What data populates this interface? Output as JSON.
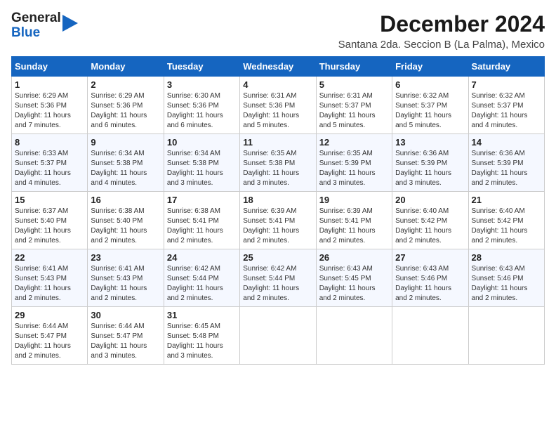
{
  "header": {
    "logo_line1": "General",
    "logo_line2": "Blue",
    "month": "December 2024",
    "location": "Santana 2da. Seccion B (La Palma), Mexico"
  },
  "days_of_week": [
    "Sunday",
    "Monday",
    "Tuesday",
    "Wednesday",
    "Thursday",
    "Friday",
    "Saturday"
  ],
  "weeks": [
    [
      {
        "day": "1",
        "info": "Sunrise: 6:29 AM\nSunset: 5:36 PM\nDaylight: 11 hours\nand 7 minutes."
      },
      {
        "day": "2",
        "info": "Sunrise: 6:29 AM\nSunset: 5:36 PM\nDaylight: 11 hours\nand 6 minutes."
      },
      {
        "day": "3",
        "info": "Sunrise: 6:30 AM\nSunset: 5:36 PM\nDaylight: 11 hours\nand 6 minutes."
      },
      {
        "day": "4",
        "info": "Sunrise: 6:31 AM\nSunset: 5:36 PM\nDaylight: 11 hours\nand 5 minutes."
      },
      {
        "day": "5",
        "info": "Sunrise: 6:31 AM\nSunset: 5:37 PM\nDaylight: 11 hours\nand 5 minutes."
      },
      {
        "day": "6",
        "info": "Sunrise: 6:32 AM\nSunset: 5:37 PM\nDaylight: 11 hours\nand 5 minutes."
      },
      {
        "day": "7",
        "info": "Sunrise: 6:32 AM\nSunset: 5:37 PM\nDaylight: 11 hours\nand 4 minutes."
      }
    ],
    [
      {
        "day": "8",
        "info": "Sunrise: 6:33 AM\nSunset: 5:37 PM\nDaylight: 11 hours\nand 4 minutes."
      },
      {
        "day": "9",
        "info": "Sunrise: 6:34 AM\nSunset: 5:38 PM\nDaylight: 11 hours\nand 4 minutes."
      },
      {
        "day": "10",
        "info": "Sunrise: 6:34 AM\nSunset: 5:38 PM\nDaylight: 11 hours\nand 3 minutes."
      },
      {
        "day": "11",
        "info": "Sunrise: 6:35 AM\nSunset: 5:38 PM\nDaylight: 11 hours\nand 3 minutes."
      },
      {
        "day": "12",
        "info": "Sunrise: 6:35 AM\nSunset: 5:39 PM\nDaylight: 11 hours\nand 3 minutes."
      },
      {
        "day": "13",
        "info": "Sunrise: 6:36 AM\nSunset: 5:39 PM\nDaylight: 11 hours\nand 3 minutes."
      },
      {
        "day": "14",
        "info": "Sunrise: 6:36 AM\nSunset: 5:39 PM\nDaylight: 11 hours\nand 2 minutes."
      }
    ],
    [
      {
        "day": "15",
        "info": "Sunrise: 6:37 AM\nSunset: 5:40 PM\nDaylight: 11 hours\nand 2 minutes."
      },
      {
        "day": "16",
        "info": "Sunrise: 6:38 AM\nSunset: 5:40 PM\nDaylight: 11 hours\nand 2 minutes."
      },
      {
        "day": "17",
        "info": "Sunrise: 6:38 AM\nSunset: 5:41 PM\nDaylight: 11 hours\nand 2 minutes."
      },
      {
        "day": "18",
        "info": "Sunrise: 6:39 AM\nSunset: 5:41 PM\nDaylight: 11 hours\nand 2 minutes."
      },
      {
        "day": "19",
        "info": "Sunrise: 6:39 AM\nSunset: 5:41 PM\nDaylight: 11 hours\nand 2 minutes."
      },
      {
        "day": "20",
        "info": "Sunrise: 6:40 AM\nSunset: 5:42 PM\nDaylight: 11 hours\nand 2 minutes."
      },
      {
        "day": "21",
        "info": "Sunrise: 6:40 AM\nSunset: 5:42 PM\nDaylight: 11 hours\nand 2 minutes."
      }
    ],
    [
      {
        "day": "22",
        "info": "Sunrise: 6:41 AM\nSunset: 5:43 PM\nDaylight: 11 hours\nand 2 minutes."
      },
      {
        "day": "23",
        "info": "Sunrise: 6:41 AM\nSunset: 5:43 PM\nDaylight: 11 hours\nand 2 minutes."
      },
      {
        "day": "24",
        "info": "Sunrise: 6:42 AM\nSunset: 5:44 PM\nDaylight: 11 hours\nand 2 minutes."
      },
      {
        "day": "25",
        "info": "Sunrise: 6:42 AM\nSunset: 5:44 PM\nDaylight: 11 hours\nand 2 minutes."
      },
      {
        "day": "26",
        "info": "Sunrise: 6:43 AM\nSunset: 5:45 PM\nDaylight: 11 hours\nand 2 minutes."
      },
      {
        "day": "27",
        "info": "Sunrise: 6:43 AM\nSunset: 5:46 PM\nDaylight: 11 hours\nand 2 minutes."
      },
      {
        "day": "28",
        "info": "Sunrise: 6:43 AM\nSunset: 5:46 PM\nDaylight: 11 hours\nand 2 minutes."
      }
    ],
    [
      {
        "day": "29",
        "info": "Sunrise: 6:44 AM\nSunset: 5:47 PM\nDaylight: 11 hours\nand 2 minutes."
      },
      {
        "day": "30",
        "info": "Sunrise: 6:44 AM\nSunset: 5:47 PM\nDaylight: 11 hours\nand 3 minutes."
      },
      {
        "day": "31",
        "info": "Sunrise: 6:45 AM\nSunset: 5:48 PM\nDaylight: 11 hours\nand 3 minutes."
      },
      {
        "day": "",
        "info": ""
      },
      {
        "day": "",
        "info": ""
      },
      {
        "day": "",
        "info": ""
      },
      {
        "day": "",
        "info": ""
      }
    ]
  ]
}
